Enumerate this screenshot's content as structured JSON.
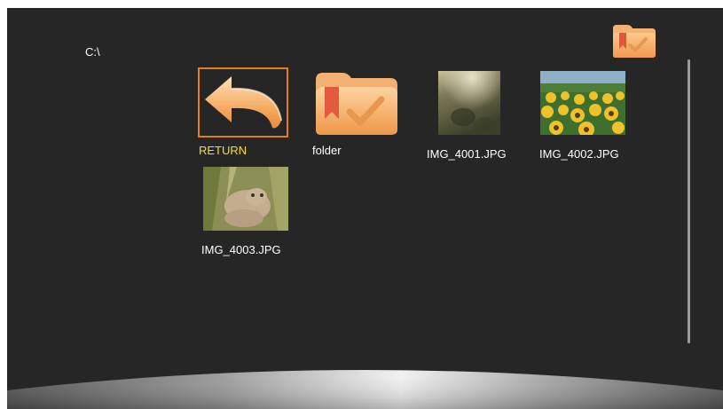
{
  "header": {
    "path": "C:\\",
    "folder_icon": "folder-bookmark-icon"
  },
  "files": [
    {
      "name": "RETURN",
      "type": "return",
      "icon": "return-arrow-icon",
      "selected": true
    },
    {
      "name": "folder",
      "type": "folder",
      "icon": "folder-bookmark-icon",
      "selected": false
    },
    {
      "name": "IMG_4001.JPG",
      "type": "image",
      "selected": false
    },
    {
      "name": "IMG_4002.JPG",
      "type": "image",
      "selected": false
    },
    {
      "name": "IMG_4003.JPG",
      "type": "image",
      "selected": false
    }
  ],
  "colors": {
    "background": "#262626",
    "selection_frame": "#e07f1b",
    "selected_label": "#f5e11c",
    "folder_orange": "#f2a35a"
  }
}
